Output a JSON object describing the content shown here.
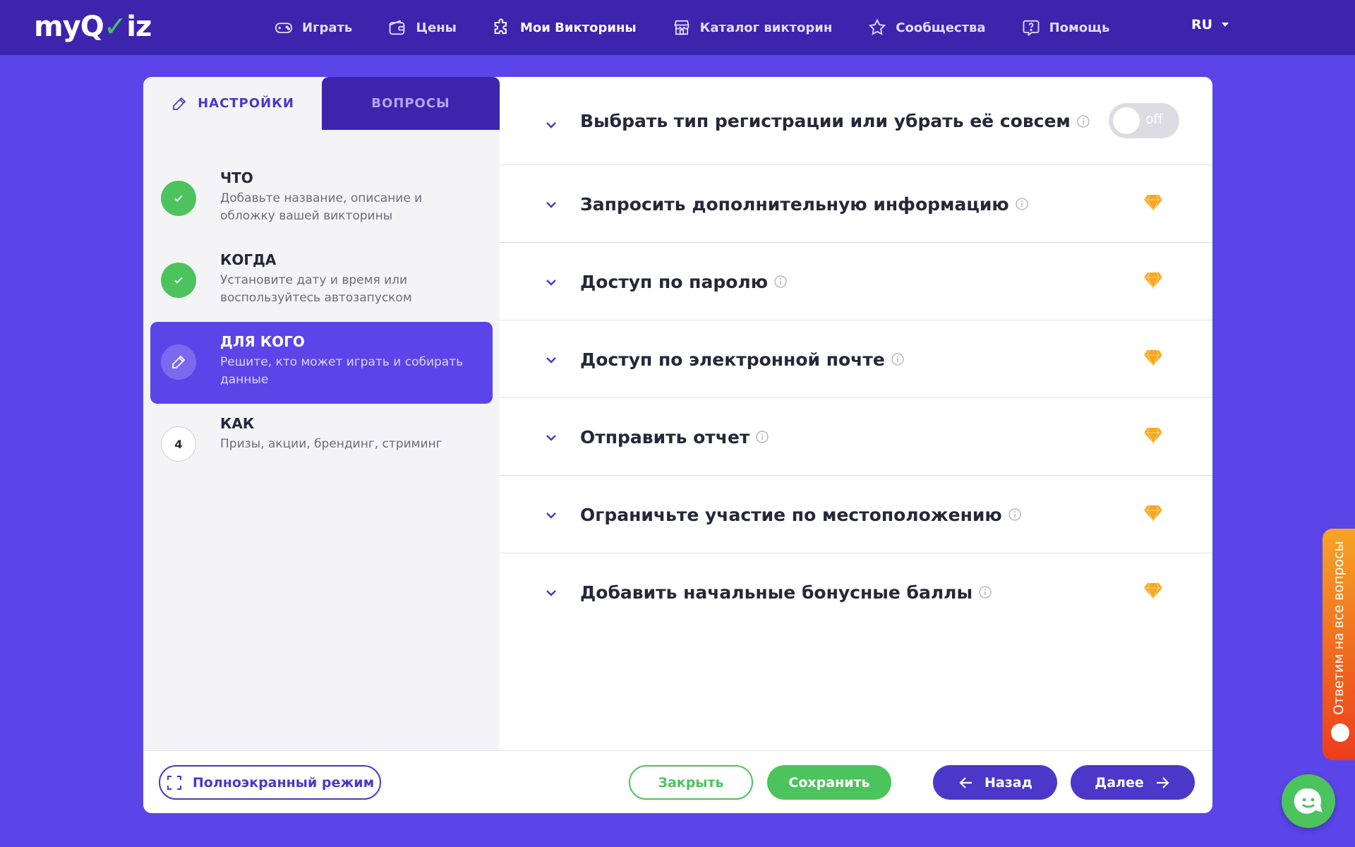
{
  "logo": {
    "text_prefix": "my",
    "text_q": "Q",
    "text_check": "✓",
    "text_suffix": "iz"
  },
  "nav": {
    "items": [
      {
        "label": "Играть",
        "icon": "gamepad-icon"
      },
      {
        "label": "Цены",
        "icon": "wallet-icon"
      },
      {
        "label": "Мои Викторины",
        "icon": "puzzle-icon"
      },
      {
        "label": "Каталог викторин",
        "icon": "store-icon"
      },
      {
        "label": "Сообщества",
        "icon": "star-icon"
      },
      {
        "label": "Помощь",
        "icon": "help-icon"
      }
    ],
    "active_index": 2,
    "language": "RU"
  },
  "tabs": {
    "settings": "НАСТРОЙКИ",
    "questions": "ВОПРОСЫ"
  },
  "steps": [
    {
      "title": "ЧТО",
      "description": "Добавьте название, описание и обложку вашей викторины",
      "status": "done"
    },
    {
      "title": "КОГДА",
      "description": "Установите дату и время или воспользуйтесь автозапуском",
      "status": "done"
    },
    {
      "title": "ДЛЯ КОГО",
      "description": "Решите, кто может играть и собирать данные",
      "status": "current"
    },
    {
      "title": "КАК",
      "description": "Призы, акции, брендинг, стриминг",
      "status": "todo",
      "number": "4"
    }
  ],
  "settings": {
    "rows": [
      {
        "label": "Выбрать тип регистрации или убрать её совсем",
        "control": "toggle",
        "toggle_text": "off"
      },
      {
        "label": "Запросить дополнительную информацию",
        "control": "premium"
      },
      {
        "label": "Доступ по паролю",
        "control": "premium"
      },
      {
        "label": "Доступ по электронной почте",
        "control": "premium"
      },
      {
        "label": "Отправить отчет",
        "control": "premium"
      },
      {
        "label": "Ограничьте участие по местоположению",
        "control": "premium"
      },
      {
        "label": "Добавить начальные бонусные баллы",
        "control": "premium"
      }
    ]
  },
  "footer": {
    "fullscreen": "Полноэкранный режим",
    "close": "Закрыть",
    "save": "Сохранить",
    "back": "Назад",
    "next": "Далее"
  },
  "feedback_tab": "Ответим на все вопросы",
  "colors": {
    "brand_purple": "#5b45e8",
    "nav_dark": "#3c24ad",
    "accent_green": "#4cc35d",
    "premium_gold": "#f7a625"
  }
}
